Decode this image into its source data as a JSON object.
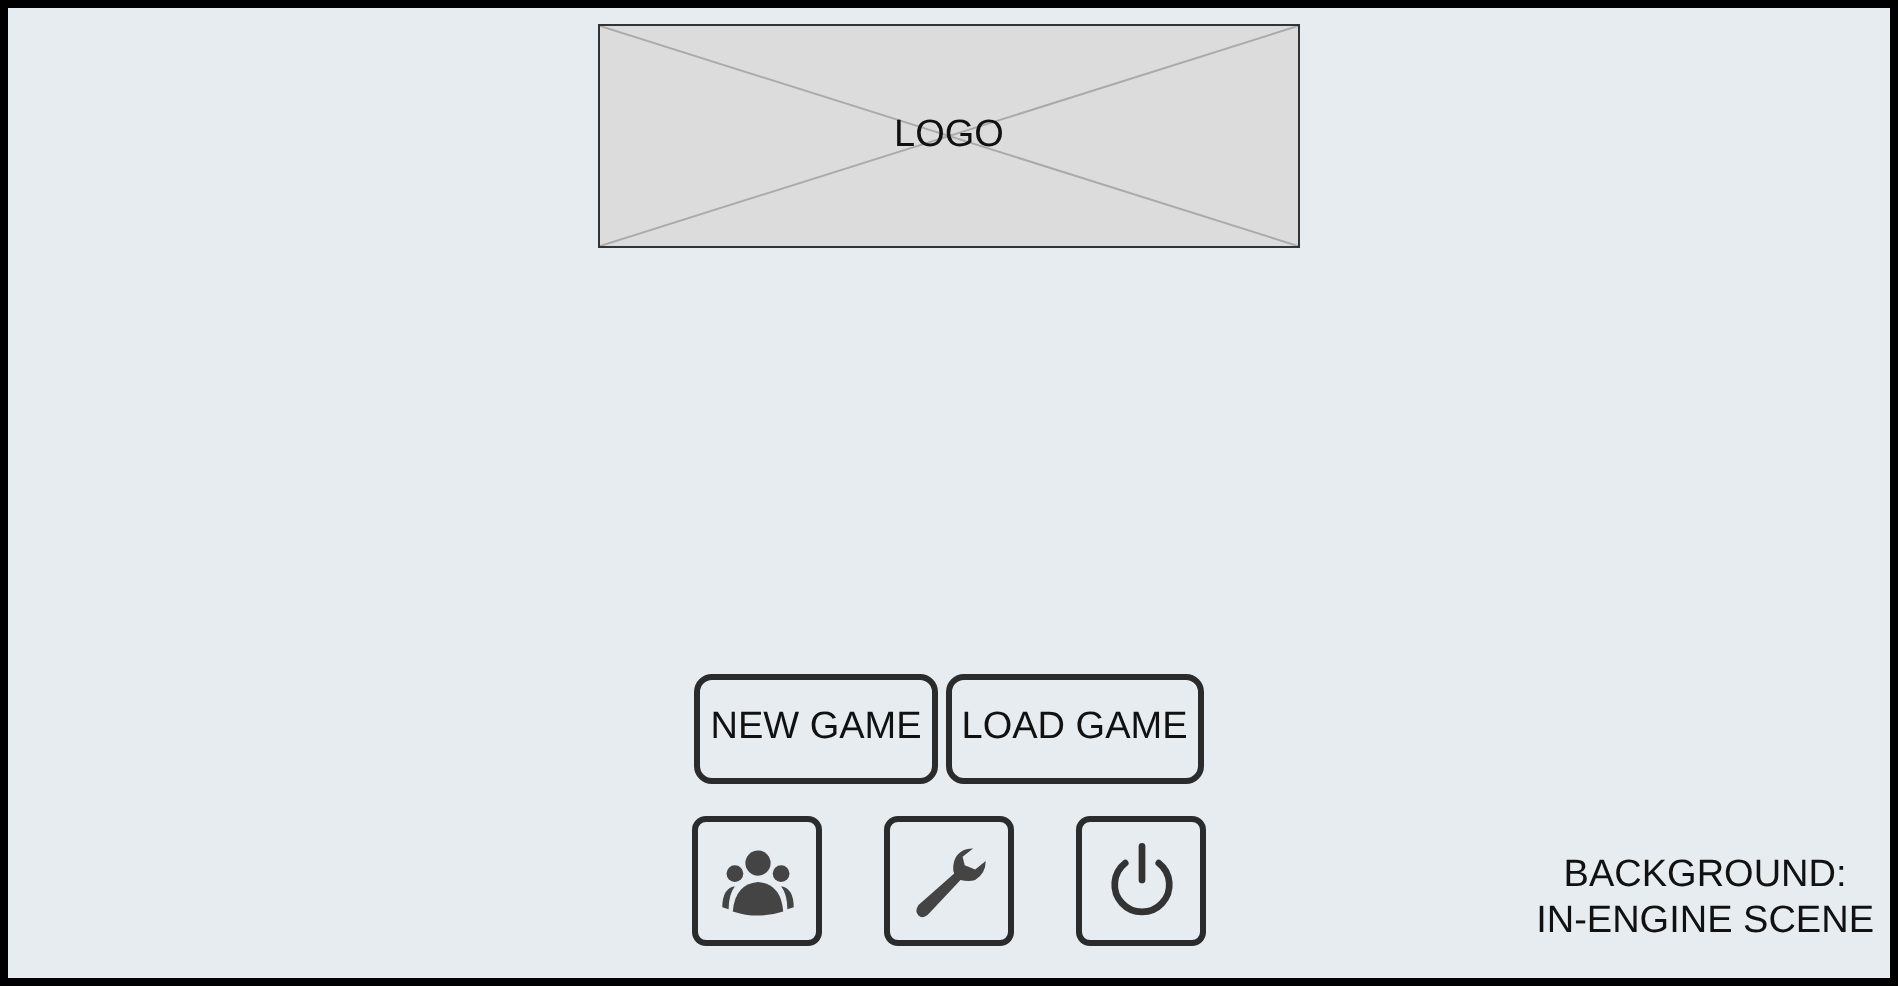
{
  "logo": {
    "label": "LOGO"
  },
  "menu_buttons": [
    "NEW GAME",
    "LOAD GAME"
  ],
  "icon_buttons": [
    {
      "kind": "people"
    },
    {
      "kind": "wrench"
    },
    {
      "kind": "power"
    }
  ],
  "note": {
    "lines": [
      "BACKGROUND:",
      "IN-ENGINE SCENE"
    ]
  }
}
